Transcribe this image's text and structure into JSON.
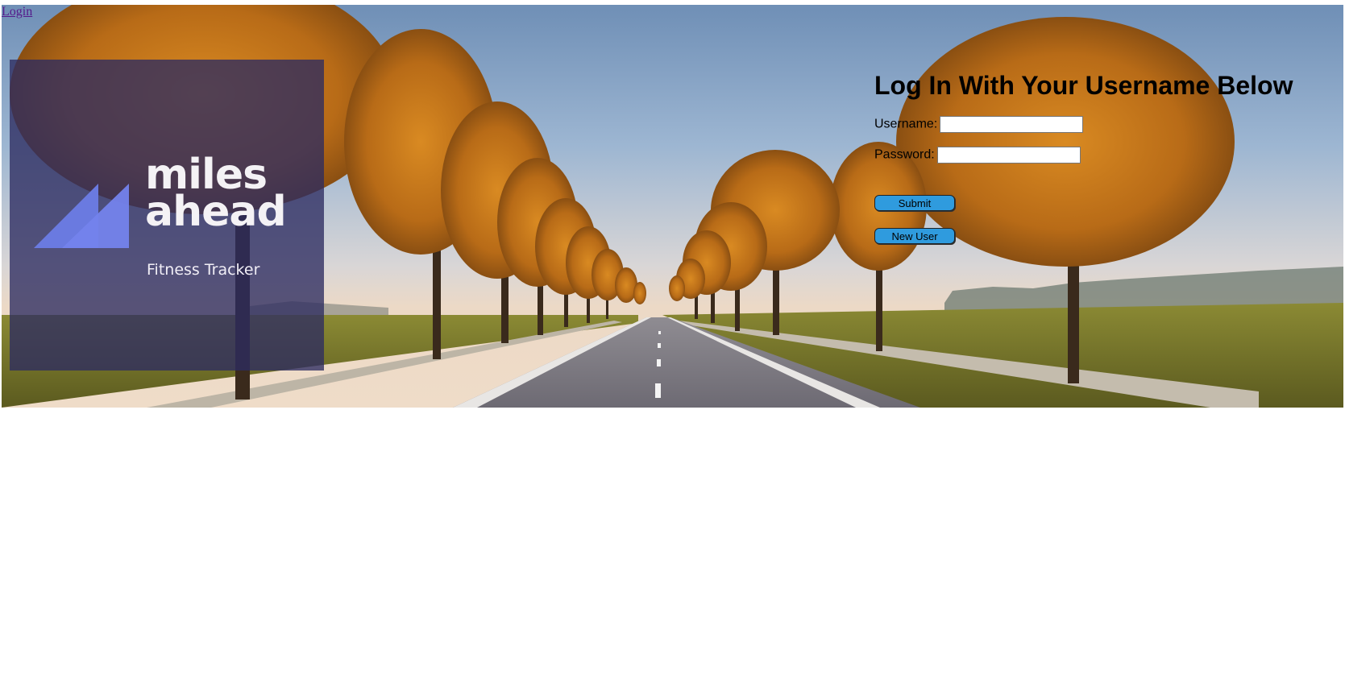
{
  "nav": {
    "login_link": "Login"
  },
  "brand": {
    "word1": "miles",
    "word2": "ahead",
    "tagline": "Fitness Tracker"
  },
  "login": {
    "title": "Log In With Your Username Below",
    "username_label": "Username:",
    "username_value": "",
    "password_label": "Password:",
    "password_value": "",
    "submit_label": "Submit",
    "new_user_label": "New User"
  },
  "colors": {
    "panel": "#2d2c60",
    "button": "#2f9bde",
    "logo_mark": "#6f7ee6",
    "link": "#551a8b"
  },
  "hero_image": "autumn-tree-lined-road-photo"
}
